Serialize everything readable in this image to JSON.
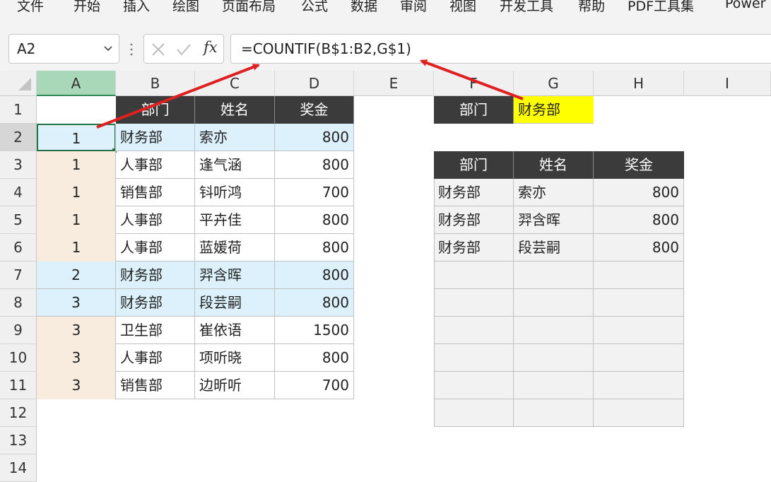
{
  "menu": [
    "文件",
    "开始",
    "插入",
    "绘图",
    "页面布局",
    "公式",
    "数据",
    "审阅",
    "视图",
    "开发工具",
    "帮助",
    "PDF工具集",
    "Power"
  ],
  "formula_bar": {
    "name_box": "A2",
    "formula": "=COUNTIF(B$1:B2,G$1)",
    "fx_label": "fx",
    "cancel_icon": "close-icon",
    "confirm_icon": "check-icon"
  },
  "columns": [
    "A",
    "B",
    "C",
    "D",
    "E",
    "F",
    "G",
    "H",
    "I"
  ],
  "rows": [
    "1",
    "2",
    "3",
    "4",
    "5",
    "6",
    "7",
    "8",
    "9",
    "10",
    "11",
    "12",
    "13",
    "14"
  ],
  "table": {
    "headers": [
      "部门",
      "姓名",
      "奖金"
    ],
    "rows": [
      {
        "a": "1",
        "dept": "财务部",
        "name": "索亦",
        "bonus": "800"
      },
      {
        "a": "1",
        "dept": "人事部",
        "name": "逢气涵",
        "bonus": "800"
      },
      {
        "a": "1",
        "dept": "销售部",
        "name": "钭听鸿",
        "bonus": "700"
      },
      {
        "a": "1",
        "dept": "人事部",
        "name": "平卉佳",
        "bonus": "800"
      },
      {
        "a": "1",
        "dept": "人事部",
        "name": "蓝媛荷",
        "bonus": "800"
      },
      {
        "a": "2",
        "dept": "财务部",
        "name": "羿含晖",
        "bonus": "800"
      },
      {
        "a": "3",
        "dept": "财务部",
        "name": "段芸嗣",
        "bonus": "800"
      },
      {
        "a": "3",
        "dept": "卫生部",
        "name": "崔依语",
        "bonus": "1500"
      },
      {
        "a": "3",
        "dept": "人事部",
        "name": "项听晓",
        "bonus": "800"
      },
      {
        "a": "3",
        "dept": "销售部",
        "name": "边昕听",
        "bonus": "700"
      }
    ]
  },
  "criteria": {
    "label": "部门",
    "value": "财务部"
  },
  "result": {
    "headers": [
      "部门",
      "姓名",
      "奖金"
    ],
    "rows": [
      {
        "dept": "财务部",
        "name": "索亦",
        "bonus": "800"
      },
      {
        "dept": "财务部",
        "name": "羿含晖",
        "bonus": "800"
      },
      {
        "dept": "财务部",
        "name": "段芸嗣",
        "bonus": "800"
      }
    ],
    "empty_rows": 6
  },
  "colors": {
    "header_dark": "#3b3b3b",
    "highlight_blue": "#dcf1fb",
    "col_a_beige": "#f7ecdd",
    "criteria_yellow": "#ffff00",
    "result_bg": "#f2f2f2",
    "arrow_red": "#e02020",
    "selected_col": "#a9d8b8"
  }
}
